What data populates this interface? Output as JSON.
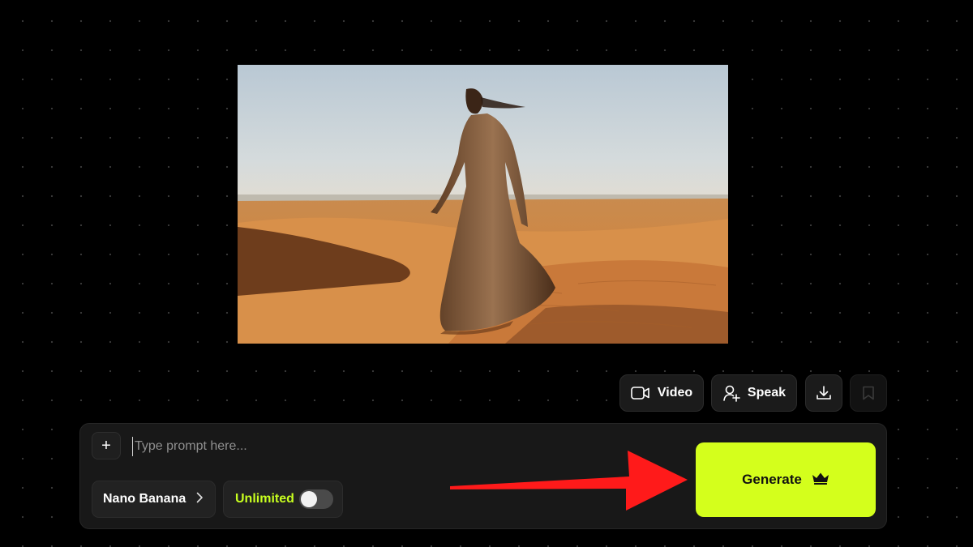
{
  "actions": {
    "video_label": "Video",
    "speak_label": "Speak",
    "video_icon": "video-camera-icon",
    "speak_icon": "user-sparkle-icon",
    "download_icon": "download-icon",
    "bookmark_icon": "bookmark-icon"
  },
  "prompt": {
    "placeholder": "Type prompt here...",
    "value": "",
    "add_icon": "plus-icon"
  },
  "model": {
    "label": "Nano Banana",
    "icon": "chevron-right-icon"
  },
  "unlimited": {
    "label": "Unlimited",
    "enabled": false
  },
  "generate": {
    "label": "Generate",
    "icon": "crown-icon"
  },
  "image": {
    "subject": "woman-walking-in-desert-photo"
  },
  "colors": {
    "accent": "#d4ff1c",
    "annotation_arrow": "#ff1a1a",
    "background": "#000000",
    "panel": "#181818"
  }
}
